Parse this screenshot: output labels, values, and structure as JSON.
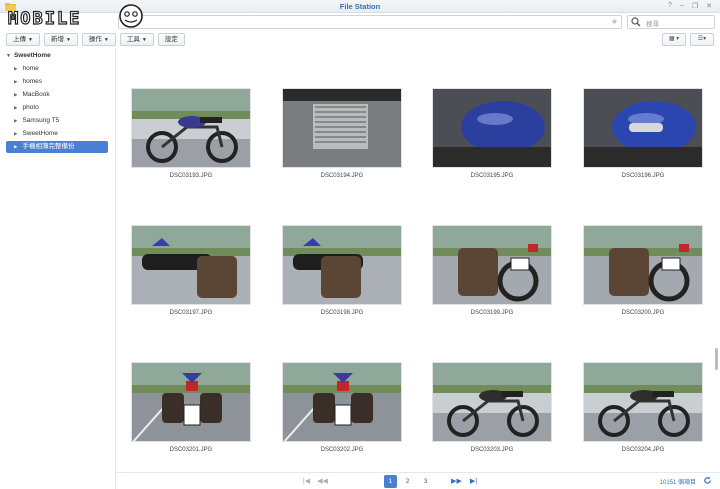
{
  "window": {
    "title": "File Station",
    "controls": [
      "?",
      "–",
      "❐",
      "✕"
    ]
  },
  "watermark": {
    "text": "MOBILE01"
  },
  "search": {
    "placeholder": "搜尋"
  },
  "toolbar": {
    "upload": "上傳",
    "create": "新增",
    "action": "操作",
    "tools": "工具",
    "settings": "設定"
  },
  "sidebar": {
    "root": "SweetHome",
    "items": [
      {
        "label": "home"
      },
      {
        "label": "homes"
      },
      {
        "label": "MacBook"
      },
      {
        "label": "photo"
      },
      {
        "label": "Samsung T5"
      },
      {
        "label": "SweetHome"
      },
      {
        "label": "手機相簿完整備份",
        "selected": true
      }
    ]
  },
  "files": [
    {
      "name": "DSC03193.JPG",
      "scene": "bike-side",
      "accent": "#3a3a8c"
    },
    {
      "name": "DSC03194.JPG",
      "scene": "engine",
      "accent": "#555555"
    },
    {
      "name": "DSC03195.JPG",
      "scene": "tank-close",
      "accent": "#2b3f9e"
    },
    {
      "name": "DSC03196.JPG",
      "scene": "tank-logo",
      "accent": "#2c46b0"
    },
    {
      "name": "DSC03197.JPG",
      "scene": "seat-bag",
      "accent": "#5b4636"
    },
    {
      "name": "DSC03198.JPG",
      "scene": "bag-close",
      "accent": "#5b4636"
    },
    {
      "name": "DSC03199.JPG",
      "scene": "rear-bag",
      "accent": "#5b4636"
    },
    {
      "name": "DSC03200.JPG",
      "scene": "rear-plate",
      "accent": "#5b4636"
    },
    {
      "name": "DSC03201.JPG",
      "scene": "rear-view",
      "accent": "#3a3aa0"
    },
    {
      "name": "DSC03202.JPG",
      "scene": "rear-view",
      "accent": "#3a3aa0"
    },
    {
      "name": "DSC03203.JPG",
      "scene": "bike-side",
      "accent": "#2e2e2e"
    },
    {
      "name": "DSC03204.JPG",
      "scene": "bike-side",
      "accent": "#2e2e2e"
    }
  ],
  "pager": {
    "pages": [
      "1",
      "2",
      "3"
    ],
    "current": "1",
    "count": "10151 個項目"
  }
}
